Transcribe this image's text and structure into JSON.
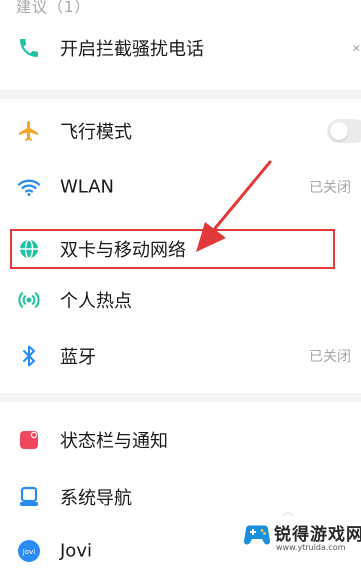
{
  "colors": {
    "accent_green": "#1fc2a3",
    "accent_orange": "#f5a623",
    "accent_blue": "#2a8bf2",
    "accent_red": "#f0475e",
    "annotation_red": "#e23a3a"
  },
  "suggestions": {
    "title": "建议（1）",
    "items": [
      {
        "label": "开启拦截骚扰电话",
        "icon": "phone-icon",
        "dismiss": "×"
      }
    ]
  },
  "settings": {
    "group1": [
      {
        "label": "飞行模式",
        "icon": "airplane-icon",
        "toggle_on": false
      },
      {
        "label": "WLAN",
        "icon": "wifi-icon",
        "status": "已关闭"
      },
      {
        "label": "双卡与移动网络",
        "icon": "globe-icon"
      },
      {
        "label": "个人热点",
        "icon": "hotspot-icon"
      },
      {
        "label": "蓝牙",
        "icon": "bluetooth-icon",
        "status": "已关闭"
      }
    ],
    "group2": [
      {
        "label": "状态栏与通知",
        "icon": "notification-icon"
      },
      {
        "label": "系统导航",
        "icon": "navigation-icon"
      },
      {
        "label": "Jovi",
        "icon": "jovi-icon",
        "badge": "Jovi"
      }
    ]
  },
  "watermark": {
    "name": "锐得游戏网",
    "url": "www.ytruida.com"
  }
}
